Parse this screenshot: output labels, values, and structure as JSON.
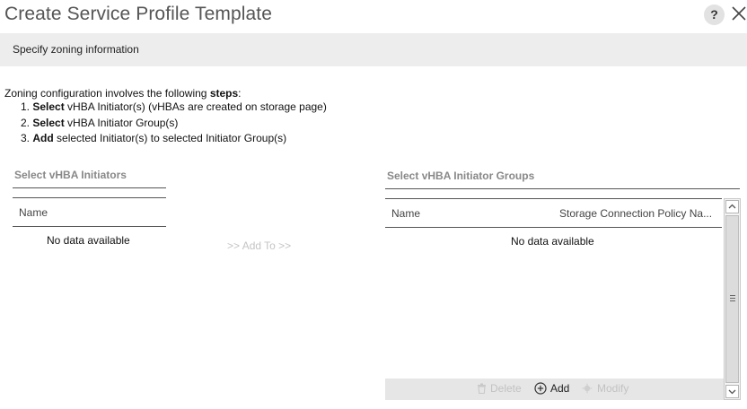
{
  "dialog": {
    "title": "Create Service Profile Template",
    "help_label": "?"
  },
  "subheader": {
    "text": "Specify zoning information"
  },
  "instructions": {
    "intro_prefix": "Zoning configuration involves the following ",
    "intro_bold": "steps",
    "intro_suffix": ":",
    "steps": [
      {
        "num": "1.",
        "bold": "Select",
        "rest": " vHBA Initiator(s) (vHBAs are created on storage page)"
      },
      {
        "num": "2.",
        "bold": "Select",
        "rest": " vHBA Initiator Group(s)"
      },
      {
        "num": "3.",
        "bold": "Add",
        "rest": " selected Initiator(s) to selected Initiator Group(s)"
      }
    ]
  },
  "initiators_panel": {
    "title": "Select vHBA Initiators",
    "column_name": "Name",
    "empty_text": "No data available"
  },
  "add_to_label": ">> Add To >>",
  "groups_panel": {
    "title": "Select vHBA Initiator Groups",
    "column_name": "Name",
    "column_policy": "Storage Connection Policy Na...",
    "empty_text": "No data available",
    "actions": {
      "delete": "Delete",
      "add": "Add",
      "modify": "Modify"
    }
  },
  "icons": {
    "close": "close-icon",
    "delete": "trash-icon",
    "add": "plus-circle-icon",
    "modify": "modify-icon",
    "scroll_up": "chevron-up-icon",
    "scroll_down": "chevron-down-icon"
  },
  "colors": {
    "subheader_bg": "#ededed",
    "disabled_text": "#c2c2c2",
    "panel_title": "#888888"
  }
}
